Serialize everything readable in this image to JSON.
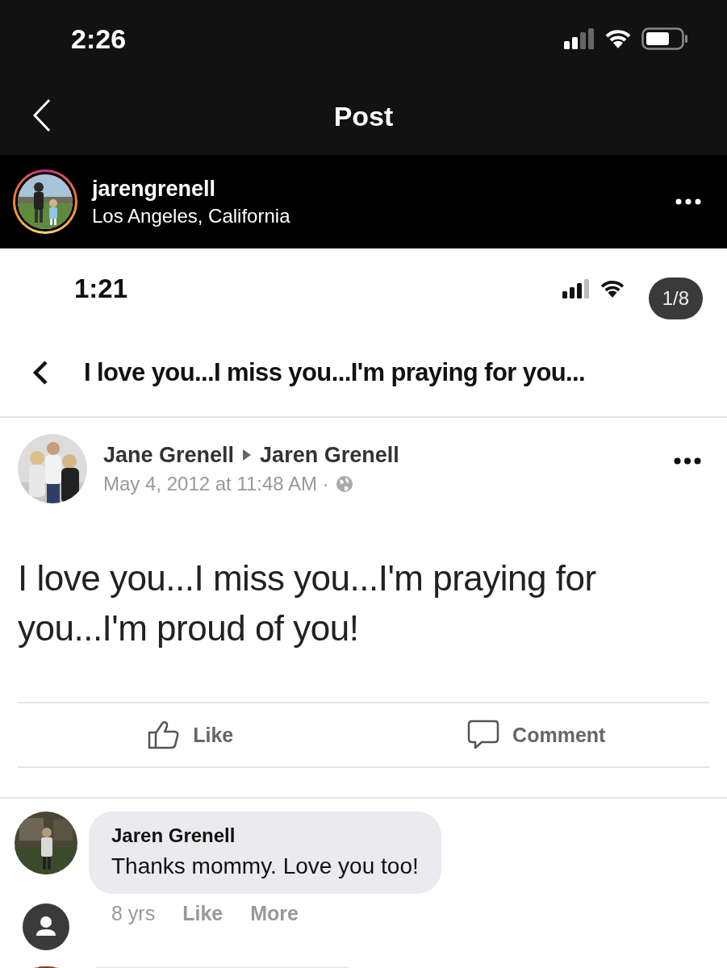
{
  "status_bar": {
    "time": "2:26"
  },
  "nav": {
    "title": "Post"
  },
  "post_header": {
    "username": "jarengrenell",
    "location": "Los Angeles, California"
  },
  "photo": {
    "page_indicator": "1/8",
    "status_bar": {
      "time": "1:21"
    },
    "title": "I love you...I miss you...I'm praying for you...",
    "post": {
      "author": "Jane Grenell",
      "target": "Jaren Grenell",
      "timestamp": "May 4, 2012 at 11:48 AM ·",
      "message": "I love you...I miss you...I'm praying for you...I'm proud of you!",
      "actions": [
        {
          "kind": "like",
          "label": "Like"
        },
        {
          "kind": "comment",
          "label": "Comment"
        }
      ]
    },
    "comments": [
      {
        "author": "Jaren Grenell",
        "text": "Thanks mommy. Love you too!",
        "time": "8 yrs",
        "actions": [
          "Like",
          "More"
        ]
      }
    ]
  }
}
